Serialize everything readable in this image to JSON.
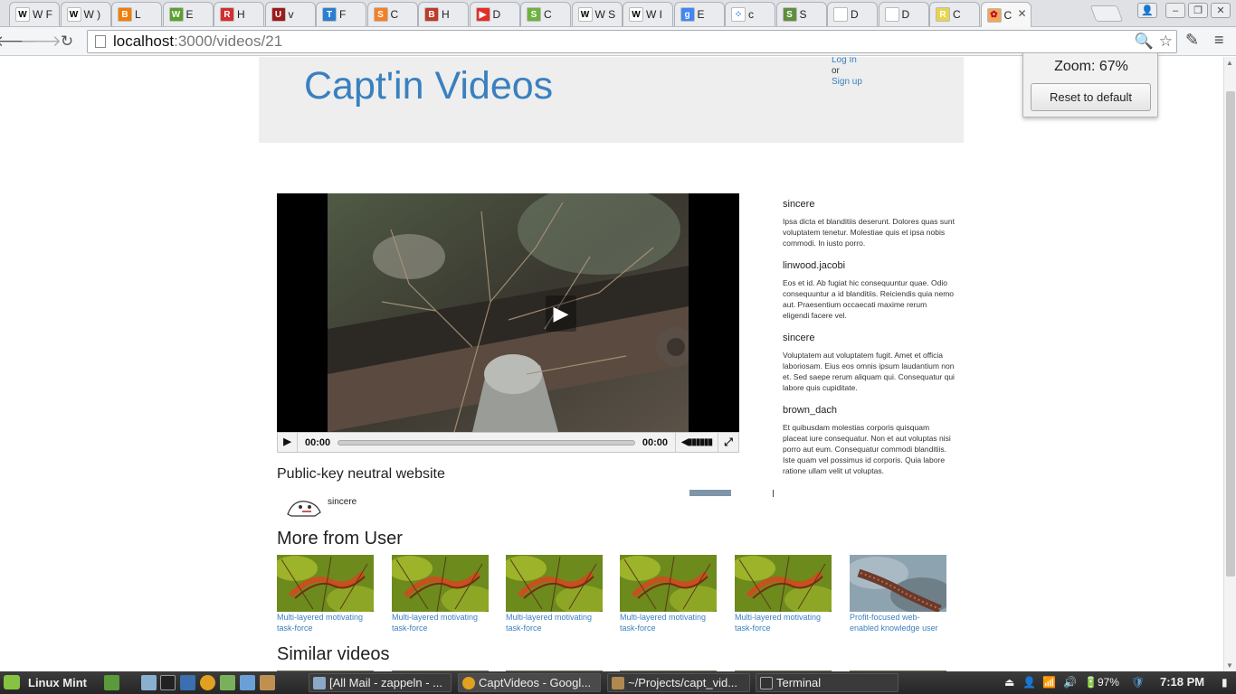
{
  "browser": {
    "tabs": [
      {
        "label": "W F",
        "fav": "W",
        "favcolor": "#ffffff",
        "favtext": "#000"
      },
      {
        "label": "W )",
        "fav": "W",
        "favcolor": "#ffffff",
        "favtext": "#000"
      },
      {
        "label": "L",
        "fav": "B",
        "favcolor": "#f57d00",
        "favtext": "#fff"
      },
      {
        "label": "E",
        "fav": "W",
        "favcolor": "#5aa02c",
        "favtext": "#fff"
      },
      {
        "label": "H",
        "fav": "R",
        "favcolor": "#d62d2d",
        "favtext": "#fff"
      },
      {
        "label": "v",
        "fav": "U",
        "favcolor": "#9c1b1b",
        "favtext": "#fff"
      },
      {
        "label": "F",
        "fav": "T",
        "favcolor": "#2a7fd4",
        "favtext": "#fff"
      },
      {
        "label": "C",
        "fav": "S",
        "favcolor": "#f48024",
        "favtext": "#fff"
      },
      {
        "label": "H",
        "fav": "B",
        "favcolor": "#c0392b",
        "favtext": "#fff"
      },
      {
        "label": "D",
        "fav": "▶",
        "favcolor": "#e52d27",
        "favtext": "#fff"
      },
      {
        "label": "C",
        "fav": "S",
        "favcolor": "#6db33f",
        "favtext": "#fff"
      },
      {
        "label": "W S",
        "fav": "W",
        "favcolor": "#ffffff",
        "favtext": "#000"
      },
      {
        "label": "W I",
        "fav": "W",
        "favcolor": "#ffffff",
        "favtext": "#000"
      },
      {
        "label": "E",
        "fav": "g",
        "favcolor": "#4285f4",
        "favtext": "#fff"
      },
      {
        "label": "c",
        "fav": "⁘",
        "favcolor": "#ffffff",
        "favtext": "#1a73e8"
      },
      {
        "label": "S",
        "fav": "S",
        "favcolor": "#5e8e3e",
        "favtext": "#fff"
      },
      {
        "label": "D",
        "fav": "",
        "favcolor": "#ffffff",
        "favtext": "#000"
      },
      {
        "label": "D",
        "fav": "",
        "favcolor": "#ffffff",
        "favtext": "#000"
      },
      {
        "label": "C",
        "fav": "R",
        "favcolor": "#e8d44d",
        "favtext": "#fff"
      },
      {
        "label": "C",
        "fav": "✿",
        "favcolor": "#f2a65a",
        "favtext": "#b02"
      }
    ],
    "url_host": "localhost",
    "url_path": ":3000/videos/21"
  },
  "zoom": {
    "label": "Zoom: 67%",
    "reset_label": "Reset to default"
  },
  "page": {
    "brand": "Capt'in Videos",
    "auth": {
      "login": "Log In",
      "or": "or",
      "signup": "Sign up"
    },
    "player": {
      "current_time": "00:00",
      "duration": "00:00"
    },
    "video_title": "Public-key neutral website",
    "uploader": "sincere",
    "comments": [
      {
        "author": "sincere",
        "body": "Ipsa dicta et blanditiis deserunt. Dolores quas sunt voluptatem tenetur. Molestiae quis et ipsa nobis commodi. In iusto porro."
      },
      {
        "author": "linwood.jacobi",
        "body": "Eos et id. Ab fugiat hic consequuntur quae. Odio consequuntur a id blanditiis. Reiciendis quia nemo aut. Praesentium occaecati maxime rerum eligendi facere vel."
      },
      {
        "author": "sincere",
        "body": "Voluptatem aut voluptatem fugit. Amet et officia laboriosam. Eius eos omnis ipsum laudantium non et. Sed saepe rerum aliquam qui. Consequatur qui labore quis cupiditate."
      },
      {
        "author": "brown_dach",
        "body": "Et quibusdam molestias corporis quisquam placeat iure consequatur. Non et aut voluptas nisi porro aut eum. Consequatur commodi blanditiis. Iste quam vel possimus id corporis. Quia labore ratione ullam velit ut voluptas."
      }
    ],
    "more_heading": "More from User",
    "more_videos": [
      {
        "title": "Multi-layered motivating task-force",
        "thumb": "salamander"
      },
      {
        "title": "Multi-layered motivating task-force",
        "thumb": "salamander"
      },
      {
        "title": "Multi-layered motivating task-force",
        "thumb": "salamander"
      },
      {
        "title": "Multi-layered motivating task-force",
        "thumb": "salamander"
      },
      {
        "title": "Multi-layered motivating task-force",
        "thumb": "salamander"
      },
      {
        "title": "Profit-focused web-enabled knowledge user",
        "thumb": "lizard"
      }
    ],
    "similar_heading": "Similar videos"
  },
  "taskbar": {
    "menu": "Linux Mint",
    "tasks": [
      {
        "label": "[All Mail - zappeln - ...",
        "color": "#8aa8c8"
      },
      {
        "label": "CaptVideos - Googl...",
        "color": "#e0a020"
      },
      {
        "label": "~/Projects/capt_vid...",
        "color": "#b08850"
      },
      {
        "label": "Terminal",
        "color": "#333333"
      }
    ],
    "battery": "97%",
    "clock": "7:18 PM"
  }
}
